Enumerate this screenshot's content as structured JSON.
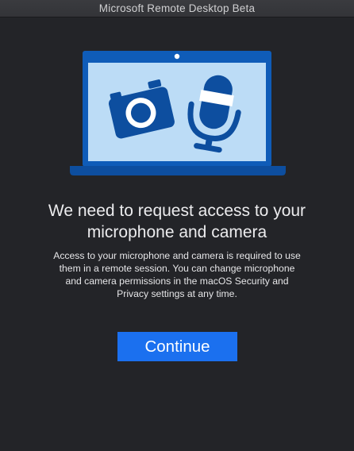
{
  "window": {
    "title": "Microsoft Remote Desktop Beta"
  },
  "illustration": {
    "icons": [
      "laptop-icon",
      "camera-icon",
      "microphone-icon"
    ],
    "colors": {
      "laptop_body": "#0f5cb8",
      "laptop_base": "#0d4e9f",
      "screen": "#bcdcf6",
      "glyph": "#0d4e9f",
      "glyph_highlight": "#ffffff"
    }
  },
  "content": {
    "heading_lines": [
      "We need to request access to your",
      "microphone and camera"
    ],
    "body_lines": [
      "Access to your microphone and camera is required to use",
      "them in a remote session. You can change microphone",
      "and camera permissions in the macOS Security and",
      "Privacy settings at any time."
    ],
    "continue_label": "Continue"
  },
  "colors": {
    "background": "#232428",
    "accent": "#1b70ef",
    "text": "#ececee"
  }
}
